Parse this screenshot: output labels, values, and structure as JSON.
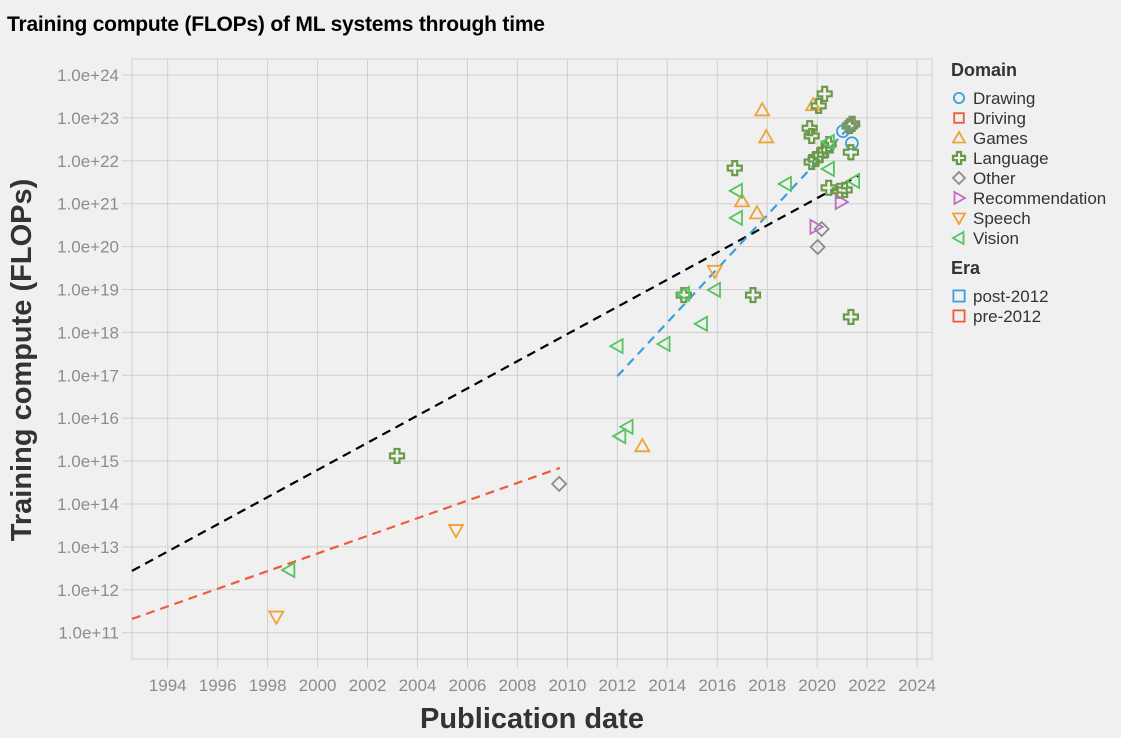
{
  "chart_data": {
    "type": "scatter",
    "title": "Training compute (FLOPs) of ML systems through time",
    "xlabel": "Publication date",
    "ylabel": "Training compute (FLOPs)",
    "xlim": [
      1992.57,
      2024.6
    ],
    "ylim_log10": [
      10.42,
      24.35
    ],
    "y_scale": "log",
    "grid": true,
    "x_ticks": [
      "1994",
      "1996",
      "1998",
      "2000",
      "2002",
      "2004",
      "2006",
      "2008",
      "2010",
      "2012",
      "2014",
      "2016",
      "2018",
      "2020",
      "2022",
      "2024"
    ],
    "x_tick_values": [
      1994,
      1996,
      1998,
      2000,
      2002,
      2004,
      2006,
      2008,
      2010,
      2012,
      2014,
      2016,
      2018,
      2020,
      2022,
      2024
    ],
    "y_ticks": [
      "1.0e+24",
      "1.0e+23",
      "1.0e+22",
      "1.0e+21",
      "1.0e+20",
      "1.0e+19",
      "1.0e+18",
      "1.0e+17",
      "1.0e+16",
      "1.0e+15",
      "1.0e+14",
      "1.0e+13",
      "1.0e+12",
      "1.0e+11"
    ],
    "y_tick_log10": [
      24,
      23,
      22,
      21,
      20,
      19,
      18,
      17,
      16,
      15,
      14,
      13,
      12,
      11
    ],
    "legend": {
      "placement": "right",
      "domain_title": "Domain",
      "domain": [
        {
          "name": "Drawing",
          "color": "#3a9fdb",
          "shape": "circle"
        },
        {
          "name": "Driving",
          "color": "#f05a3c",
          "shape": "square"
        },
        {
          "name": "Games",
          "color": "#eba436",
          "shape": "triangle-up"
        },
        {
          "name": "Language",
          "color": "#6a9a49",
          "shape": "cross"
        },
        {
          "name": "Other",
          "color": "#8c8c8c",
          "shape": "diamond"
        },
        {
          "name": "Recommendation",
          "color": "#c06ac0",
          "shape": "triangle-right"
        },
        {
          "name": "Speech",
          "color": "#f5a030",
          "shape": "triangle-down"
        },
        {
          "name": "Vision",
          "color": "#55c45f",
          "shape": "triangle-left"
        }
      ],
      "era_title": "Era",
      "era": [
        {
          "name": "post-2012",
          "color": "#3a9fdb",
          "shape": "square"
        },
        {
          "name": "pre-2012",
          "color": "#f05a3c",
          "shape": "square"
        }
      ]
    },
    "trend_lines": [
      {
        "name": "overall-trend",
        "color": "#000000",
        "x": [
          1992.57,
          2021.64
        ],
        "log10_y": [
          12.44,
          21.65
        ]
      },
      {
        "name": "pre-2012-trend",
        "color": "#f05a3c",
        "x": [
          1992.57,
          2009.7
        ],
        "log10_y": [
          11.32,
          14.84
        ]
      },
      {
        "name": "post-2012-trend",
        "color": "#3a9fdb",
        "x": [
          2012.0,
          2021.24
        ],
        "log10_y": [
          16.98,
          22.76
        ]
      }
    ],
    "series": [
      {
        "name": "Drawing",
        "points": [
          [
            2021.03,
            22.69
          ],
          [
            2021.39,
            22.41
          ]
        ]
      },
      {
        "name": "Driving",
        "points": []
      },
      {
        "name": "Games",
        "points": [
          [
            2017.8,
            23.18
          ],
          [
            2017.96,
            22.55
          ],
          [
            2016.99,
            21.06
          ],
          [
            2017.59,
            20.78
          ],
          [
            2013.0,
            15.35
          ],
          [
            2019.84,
            23.3
          ]
        ]
      },
      {
        "name": "Language",
        "points": [
          [
            2020.3,
            23.56
          ],
          [
            2020.06,
            23.28
          ],
          [
            2019.7,
            22.76
          ],
          [
            2019.78,
            22.58
          ],
          [
            2020.46,
            22.39
          ],
          [
            2020.34,
            22.25
          ],
          [
            2020.1,
            22.13
          ],
          [
            2019.94,
            22.04
          ],
          [
            2019.78,
            21.97
          ],
          [
            2021.3,
            22.81
          ],
          [
            2021.35,
            22.2
          ],
          [
            2016.7,
            21.83
          ],
          [
            2020.46,
            21.37
          ],
          [
            2020.9,
            21.3
          ],
          [
            2021.1,
            21.32
          ],
          [
            2014.66,
            18.87
          ],
          [
            2017.43,
            18.87
          ],
          [
            2021.35,
            18.36
          ],
          [
            2003.18,
            15.12
          ],
          [
            2021.4,
            22.86
          ]
        ]
      },
      {
        "name": "Other",
        "points": [
          [
            2021.3,
            22.86
          ],
          [
            2020.18,
            20.41
          ],
          [
            2020.02,
            19.99
          ],
          [
            2009.67,
            14.47
          ]
        ]
      },
      {
        "name": "Recommendation",
        "points": [
          [
            2019.94,
            20.46
          ],
          [
            2020.95,
            21.04
          ]
        ]
      },
      {
        "name": "Speech",
        "points": [
          [
            2015.9,
            19.43
          ],
          [
            2005.54,
            13.39
          ],
          [
            1998.35,
            11.37
          ]
        ]
      },
      {
        "name": "Vision",
        "points": [
          [
            2016.78,
            21.3
          ],
          [
            2018.74,
            21.46
          ],
          [
            2020.46,
            21.81
          ],
          [
            2016.78,
            20.67
          ],
          [
            2021.47,
            21.53
          ],
          [
            2014.66,
            18.9
          ],
          [
            2015.9,
            18.99
          ],
          [
            2015.38,
            18.2
          ],
          [
            2012.0,
            17.68
          ],
          [
            2013.88,
            17.73
          ],
          [
            2012.4,
            15.8
          ],
          [
            2012.11,
            15.58
          ],
          [
            1998.86,
            12.46
          ],
          [
            2020.46,
            22.44
          ]
        ]
      }
    ]
  }
}
